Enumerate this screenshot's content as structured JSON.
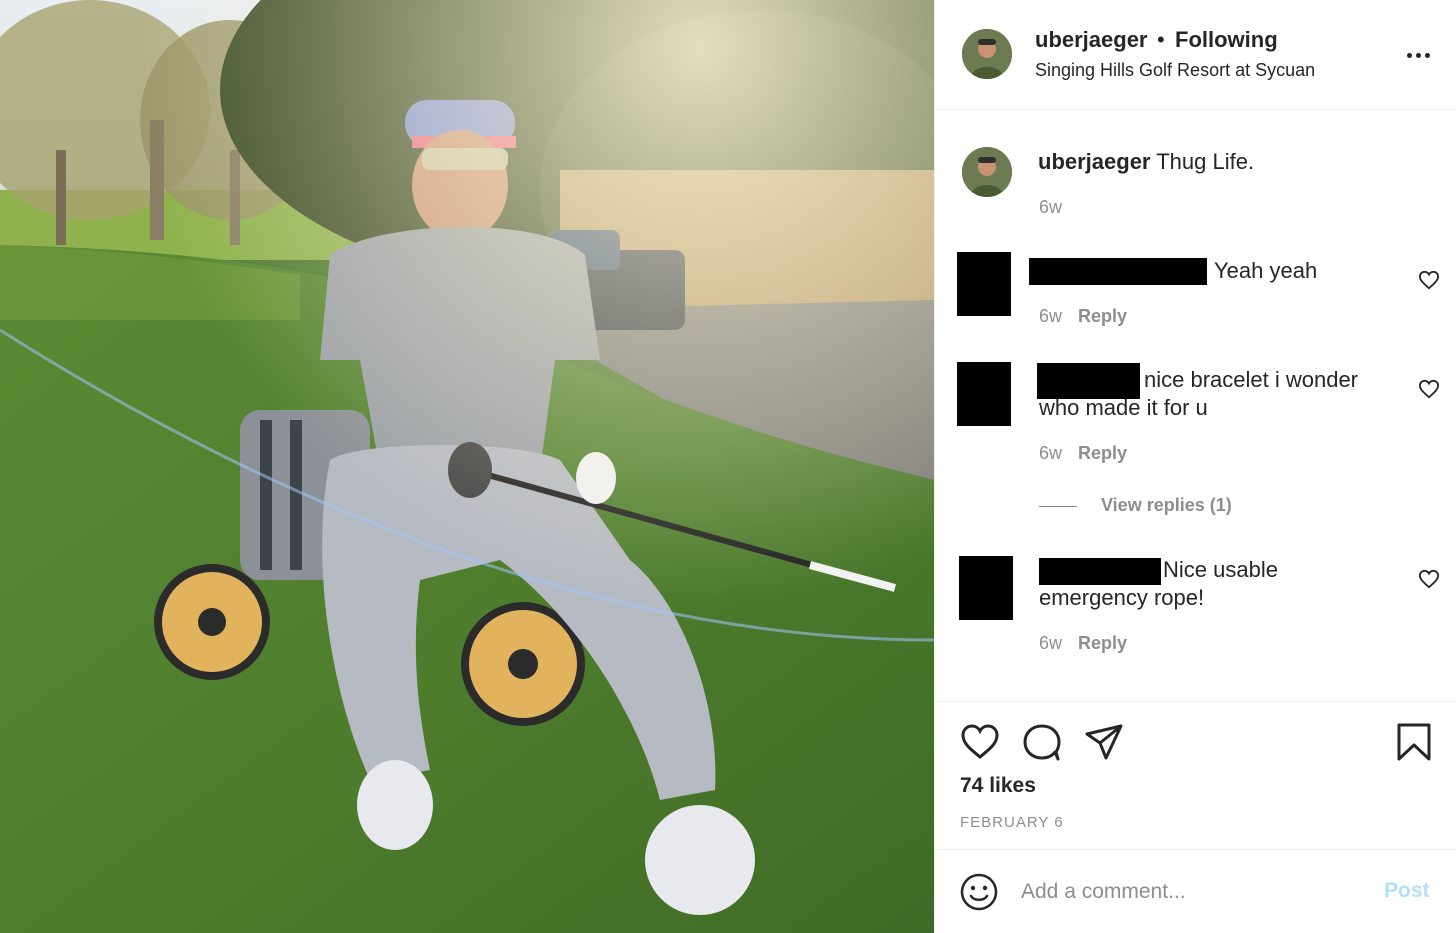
{
  "post": {
    "username": "uberjaeger",
    "separator": "•",
    "follow_status": "Following",
    "location": "Singing Hills Golf Resort at Sycuan",
    "more_icon": "ellipsis-icon"
  },
  "caption": {
    "username": "uberjaeger",
    "text": "Thug Life.",
    "time": "6w"
  },
  "comments": [
    {
      "text": "Yeah yeah",
      "time": "6w",
      "reply_label": "Reply"
    },
    {
      "text": "nice bracelet i wonder who made it for u",
      "time": "6w",
      "reply_label": "Reply",
      "view_replies": "View replies (1)"
    },
    {
      "text": "Nice usable emergency rope!",
      "time": "6w",
      "reply_label": "Reply"
    }
  ],
  "actions": {
    "icons": [
      "heart-icon",
      "comment-icon",
      "share-icon",
      "bookmark-icon"
    ],
    "likes": "74 likes",
    "date": "FEBRUARY 6"
  },
  "composer": {
    "placeholder": "Add a comment...",
    "post_label": "Post",
    "emoji_icon": "smile-icon"
  },
  "colors": {
    "text": "#262626",
    "secondary": "#8e8e8e",
    "post_disabled": "#b2dffc",
    "divider": "#efefef"
  }
}
